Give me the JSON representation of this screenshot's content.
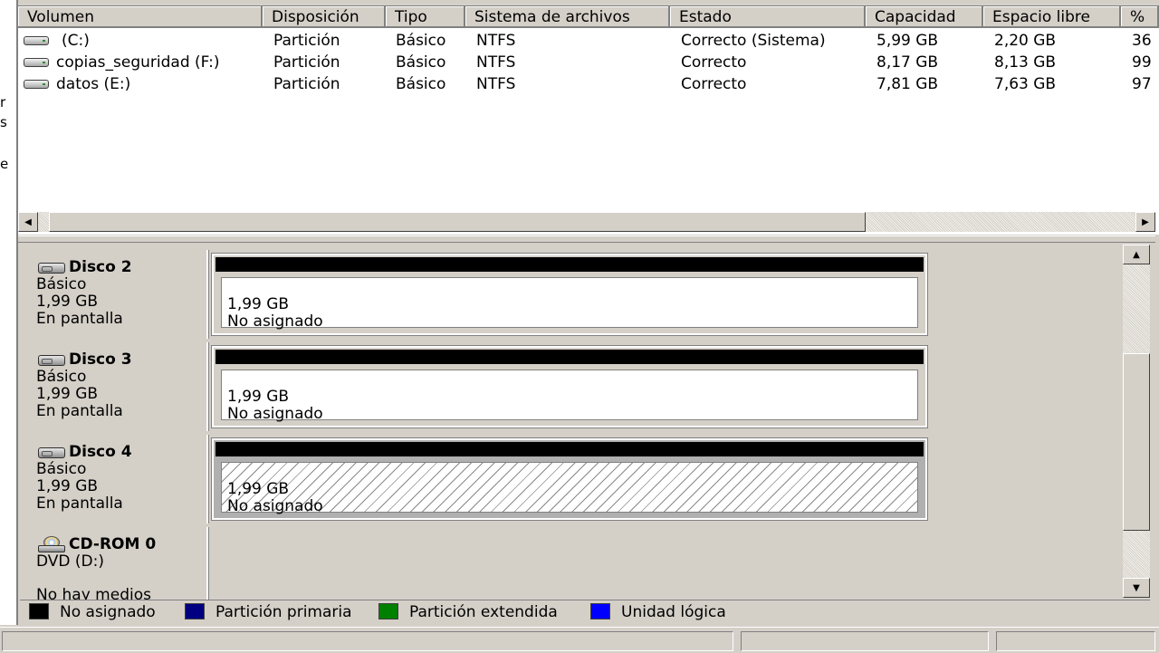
{
  "left_edge": {
    "glyphs": [
      "r",
      "s",
      "e"
    ]
  },
  "volume_list": {
    "columns": [
      "Volumen",
      "Disposición",
      "Tipo",
      "Sistema de archivos",
      "Estado",
      "Capacidad",
      "Espacio libre",
      "%"
    ],
    "rows": [
      [
        "(C:)",
        "Partición",
        "Básico",
        "NTFS",
        "Correcto (Sistema)",
        "5,99 GB",
        "2,20 GB",
        "36"
      ],
      [
        "copias_seguridad (F:)",
        "Partición",
        "Básico",
        "NTFS",
        "Correcto",
        "8,17 GB",
        "8,13 GB",
        "99"
      ],
      [
        "datos (E:)",
        "Partición",
        "Básico",
        "NTFS",
        "Correcto",
        "7,81 GB",
        "7,63 GB",
        "97"
      ]
    ]
  },
  "disks": [
    {
      "name": "Disco 2",
      "type": "Básico",
      "size": "1,99 GB",
      "status": "En pantalla",
      "partition_size": "1,99 GB",
      "partition_label": "No asignado",
      "icon": "hard-disk-icon"
    },
    {
      "name": "Disco 3",
      "type": "Básico",
      "size": "1,99 GB",
      "status": "En pantalla",
      "partition_size": "1,99 GB",
      "partition_label": "No asignado",
      "icon": "hard-disk-icon"
    },
    {
      "name": "Disco 4",
      "type": "Básico",
      "size": "1,99 GB",
      "status": "En pantalla",
      "partition_size": "1,99 GB",
      "partition_label": "No asignado",
      "icon": "hard-disk-icon"
    }
  ],
  "cdrom": {
    "name": "CD-ROM 0",
    "drive": "DVD (D:)",
    "status": "No hay medios",
    "icon": "cd-drive-icon"
  },
  "legend": [
    {
      "label": "No asignado",
      "color": "#000000"
    },
    {
      "label": "Partición primaria",
      "color": "#000080"
    },
    {
      "label": "Partición extendida",
      "color": "#008000"
    },
    {
      "label": "Unidad lógica",
      "color": "#0000ff"
    }
  ],
  "colors": {
    "window_bg": "#d4d0c8",
    "list_bg": "#ffffff",
    "unallocated_bar": "#000000"
  }
}
